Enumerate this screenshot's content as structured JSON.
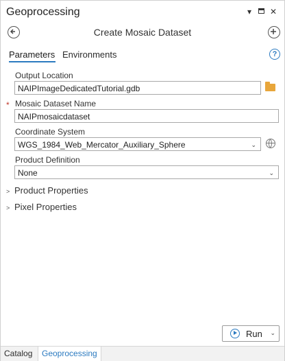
{
  "pane": {
    "title": "Geoprocessing",
    "dropdown_icon": "chevron-down-icon",
    "maximize_icon": "maximize-icon",
    "close_icon": "close-icon"
  },
  "tool": {
    "title": "Create Mosaic Dataset",
    "back_icon": "back-arrow-icon",
    "add_icon": "add-icon"
  },
  "tabs": {
    "items": [
      {
        "label": "Parameters",
        "active": true
      },
      {
        "label": "Environments",
        "active": false
      }
    ],
    "help_icon": "help-icon"
  },
  "params": {
    "output_location": {
      "label": "Output Location",
      "value": "NAIPImageDedicatedTutorial.gdb"
    },
    "mosaic_name": {
      "label": "Mosaic Dataset Name",
      "value": "NAIPmosaicdataset",
      "required_marker": "*"
    },
    "coord_system": {
      "label": "Coordinate System",
      "value": "WGS_1984_Web_Mercator_Auxiliary_Sphere"
    },
    "product_definition": {
      "label": "Product Definition",
      "value": "None"
    }
  },
  "sections": [
    {
      "label": "Product Properties"
    },
    {
      "label": "Pixel Properties"
    }
  ],
  "run": {
    "label": "Run"
  },
  "bottom_tabs": [
    {
      "label": "Catalog",
      "active": false
    },
    {
      "label": "Geoprocessing",
      "active": true
    }
  ],
  "colors": {
    "accent": "#2b7ac0",
    "required": "#c0392b",
    "folder": "#e8a63b"
  }
}
